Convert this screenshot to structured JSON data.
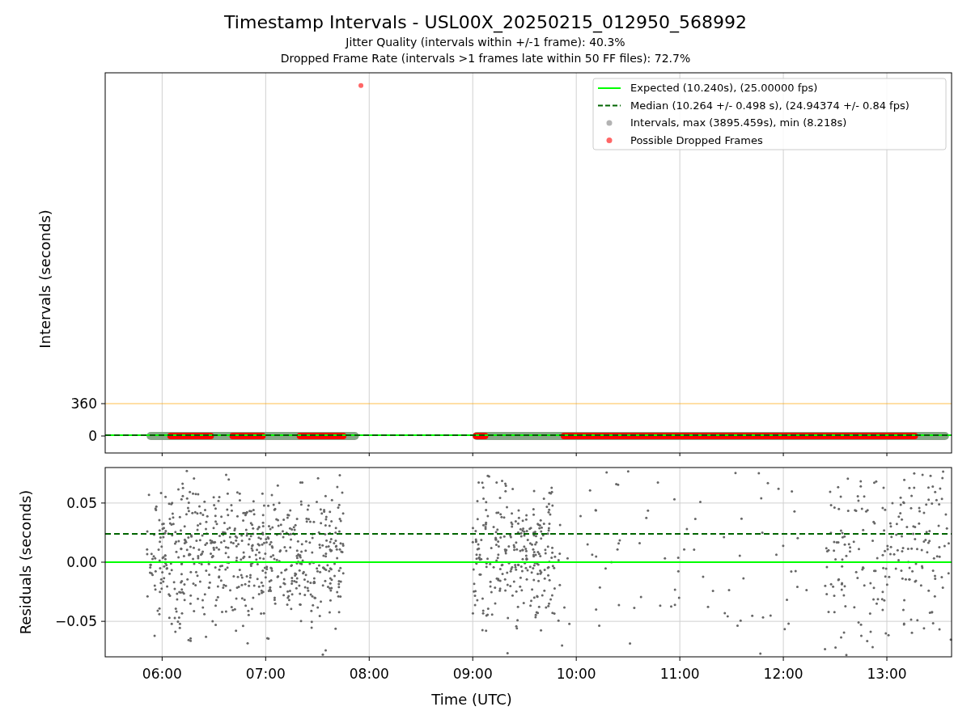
{
  "figure": {
    "title": "Timestamp Intervals - USL00X_20250215_012950_568992",
    "subtitles": [
      "Jitter Quality (intervals within +/-1 frame): 40.3%",
      "Dropped Frame Rate (intervals >1 frames late within 50 FF files): 72.7%"
    ]
  },
  "top_plot": {
    "chart_data": {
      "type": "scatter",
      "ylabel": "Intervals (seconds)",
      "xlim": [
        5.45,
        13.625
      ],
      "ylim": [
        -189,
        4041
      ],
      "yticks": [
        {
          "value": 0,
          "label": "0"
        },
        {
          "value": 360,
          "label": "360"
        }
      ],
      "x": [
        5.45,
        7.92,
        13.625
      ],
      "series": [
        {
          "name": "Expected (10.240s), (25.00000 fps)",
          "type": "line",
          "color": "#00ff00",
          "values": [
            10,
            null,
            10
          ]
        },
        {
          "name": "Median (10.264 +/- 0.498 s), (24.94374 +/- 0.84 fps)",
          "type": "line",
          "line_style": "dashed",
          "color": "#006400",
          "values": [
            10,
            null,
            10
          ]
        },
        {
          "name": "Intervals, max (3895.459s), min (8.218s)",
          "type": "scatter",
          "color": "#808080",
          "values": [
            null,
            null,
            null
          ]
        },
        {
          "name": "Possible Dropped Frames",
          "type": "scatter",
          "color": "#ff0000",
          "values": [
            null,
            3900,
            null
          ]
        }
      ],
      "grid": "x",
      "legend": "upper right",
      "ref_lines": [
        {
          "axis": "y",
          "value": 360,
          "color": "#ffa500"
        }
      ]
    }
  },
  "bottom_plot": {
    "chart_data": {
      "type": "scatter",
      "xlabel": "Time (UTC)",
      "ylabel": "Residuals (seconds)",
      "xlim": [
        5.45,
        13.625
      ],
      "ylim": [
        -0.08,
        0.08
      ],
      "xticks": [
        {
          "value": 6,
          "label": "06:00"
        },
        {
          "value": 7,
          "label": "07:00"
        },
        {
          "value": 8,
          "label": "08:00"
        },
        {
          "value": 9,
          "label": "09:00"
        },
        {
          "value": 10,
          "label": "10:00"
        },
        {
          "value": 11,
          "label": "11:00"
        },
        {
          "value": 12,
          "label": "12:00"
        },
        {
          "value": 13,
          "label": "13:00"
        }
      ],
      "yticks": [
        {
          "value": 0.05,
          "label": "0.05"
        },
        {
          "value": 0,
          "label": "0.00"
        },
        {
          "value": -0.05,
          "label": "−0.05"
        }
      ],
      "x": [
        5.45,
        13.625
      ],
      "grid": "both",
      "series": [
        {
          "type": "line",
          "color": "#00ff00",
          "values": [
            0,
            0
          ]
        },
        {
          "type": "line",
          "line_style": "dashed",
          "color": "#006400",
          "values": [
            0.024,
            0.024
          ]
        }
      ]
    }
  }
}
